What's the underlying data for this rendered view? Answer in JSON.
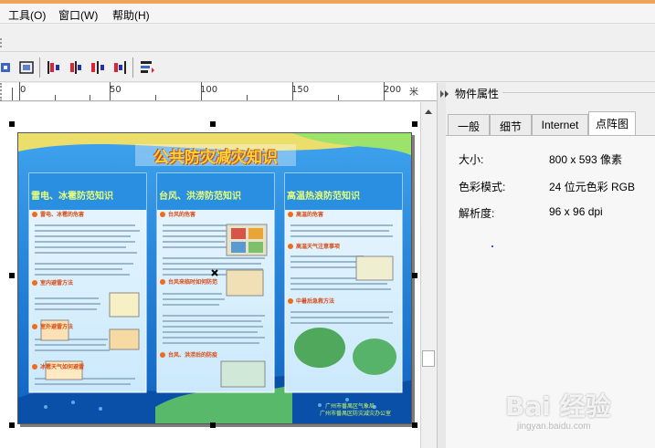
{
  "menu": [
    "工具(O)",
    "窗口(W)",
    "帮助(H)"
  ],
  "ruler": {
    "unit": "米",
    "labels": [
      "0",
      "50",
      "100",
      "150",
      "200"
    ]
  },
  "poster": {
    "title": "公共防灾减灾知识",
    "panels": [
      {
        "heading": "雷电、冰雹防范知识",
        "sub1": "雷电、冰雹的危害",
        "sub2": "室内避雷方法",
        "sub3": "室外避雷方法",
        "sub4": "冰雹天气如何避雷"
      },
      {
        "heading": "台风、洪涝防范知识",
        "sub1": "台风的危害",
        "sub2": "台风来临时如何防范",
        "sub3": "台风、洪涝后的防疫"
      },
      {
        "heading": "高温热浪防范知识",
        "sub1": "高温的危害",
        "sub2": "高温天气注意事项",
        "sub3": "中暑后急救方法"
      }
    ],
    "footer_line1": "广州市番禺区气象局",
    "footer_line2": "广州市番禺区防灾减灾办公室"
  },
  "props": {
    "title": "物件属性",
    "tabs": [
      "一般",
      "细节",
      "Internet",
      "点阵图"
    ],
    "active_tab": "点阵图",
    "rows": [
      {
        "label": "大小:",
        "value": "800 x 593 像素"
      },
      {
        "label": "色彩模式:",
        "value": "24 位元色彩  RGB"
      },
      {
        "label": "解析度:",
        "value": "96 x 96 dpi"
      }
    ]
  },
  "watermark": {
    "text": "Bai 经验",
    "sub": "jingyan.baidu.com"
  },
  "colors": {
    "poster_bg": "#1a7fd6",
    "panel_bg": "#dff1fb",
    "panel_head": "#2a8fe0",
    "title_gold": "#ffd23c",
    "accent_orange": "#f26b1d"
  }
}
